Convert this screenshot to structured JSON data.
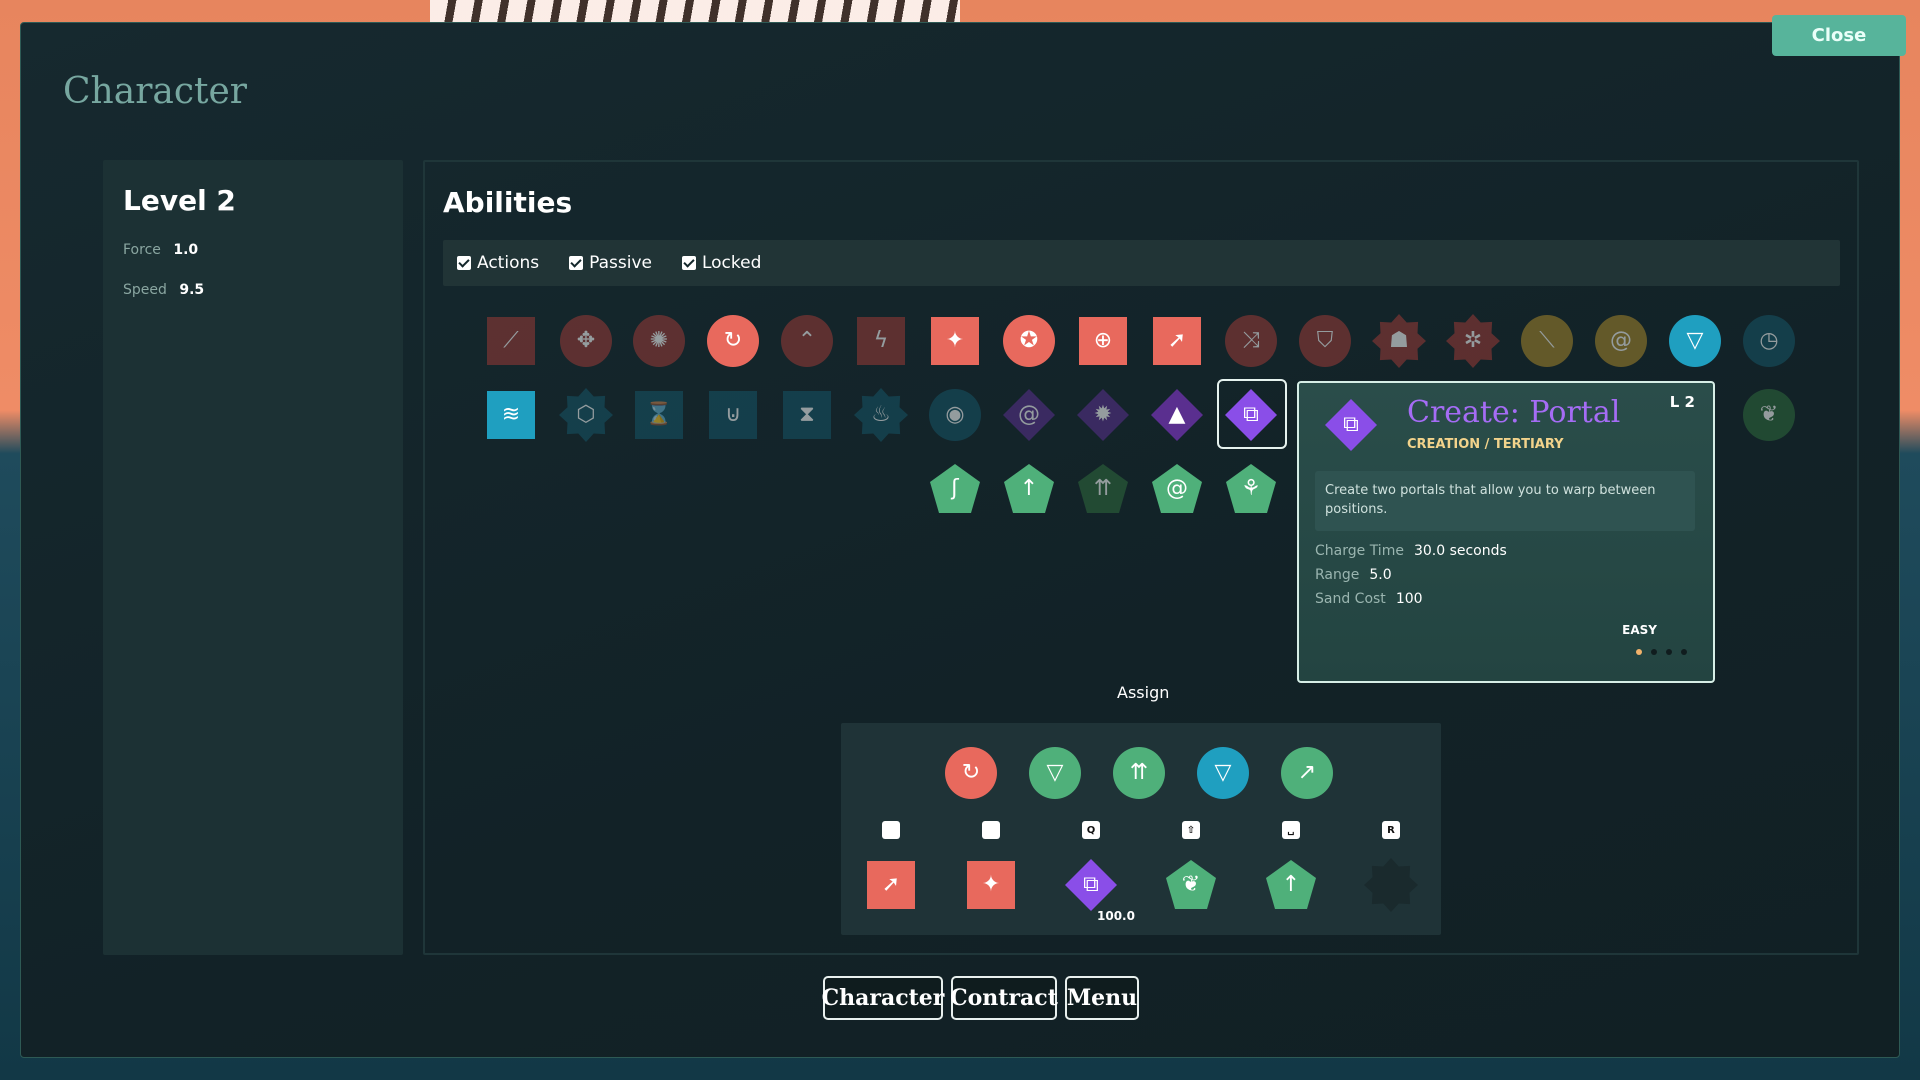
{
  "window": {
    "title": "Character",
    "close_label": "Close"
  },
  "stats": {
    "level": "Level 2",
    "items": [
      {
        "label": "Force",
        "value": "1.0"
      },
      {
        "label": "Speed",
        "value": "9.5"
      }
    ]
  },
  "abilities": {
    "title": "Abilities",
    "filters": [
      {
        "label": "Actions",
        "checked": true
      },
      {
        "label": "Passive",
        "checked": true
      },
      {
        "label": "Locked",
        "checked": true
      }
    ],
    "rows": [
      [
        {
          "icon": "claw-slash-icon",
          "color": "#9a3a36",
          "shape": "square",
          "locked": true
        },
        {
          "icon": "four-arrows-in-icon",
          "color": "#9a3a36",
          "shape": "circle",
          "locked": true
        },
        {
          "icon": "burst-arrows-icon",
          "color": "#9a3a36",
          "shape": "circle",
          "locked": true
        },
        {
          "icon": "spin-attack-icon",
          "color": "#e8695d",
          "shape": "circle",
          "locked": false
        },
        {
          "icon": "chevrons-up-icon",
          "color": "#9a3a36",
          "shape": "circle",
          "locked": true
        },
        {
          "icon": "lightning-icon",
          "color": "#9a3a36",
          "shape": "square",
          "locked": true
        },
        {
          "icon": "star-burst-icon",
          "color": "#e8695d",
          "shape": "square",
          "locked": false
        },
        {
          "icon": "pentagon-swirl-icon",
          "color": "#e8695d",
          "shape": "circle",
          "locked": false
        },
        {
          "icon": "target-icon",
          "color": "#e8695d",
          "shape": "square",
          "locked": false
        },
        {
          "icon": "dash-strike-icon",
          "color": "#e8695d",
          "shape": "square",
          "locked": false
        },
        {
          "icon": "split-arrows-icon",
          "color": "#9a3a36",
          "shape": "circle",
          "locked": true
        },
        {
          "icon": "shield-icon",
          "color": "#9a3a36",
          "shape": "circle",
          "locked": true
        },
        {
          "icon": "demon-face-icon",
          "color": "#9a3a36",
          "shape": "star",
          "locked": true
        },
        {
          "icon": "spider-icon",
          "color": "#9a3a36",
          "shape": "star",
          "locked": true
        },
        {
          "icon": "feather-blade-icon",
          "color": "#a6862a",
          "shape": "circle",
          "locked": true
        },
        {
          "icon": "spiral-icon",
          "color": "#a6862a",
          "shape": "circle",
          "locked": true
        },
        {
          "icon": "vortex-icon",
          "color": "#1f9fc0",
          "shape": "circle",
          "locked": false
        },
        {
          "icon": "stopwatch-icon",
          "color": "#165566",
          "shape": "circle",
          "locked": true
        }
      ],
      [
        {
          "icon": "wind-dash-icon",
          "color": "#1f9fc0",
          "shape": "square",
          "locked": false
        },
        {
          "icon": "cube-icon",
          "color": "#165566",
          "shape": "star",
          "locked": true
        },
        {
          "icon": "hourglass-lock-icon",
          "color": "#165566",
          "shape": "square",
          "locked": true
        },
        {
          "icon": "magnet-icon",
          "color": "#165566",
          "shape": "square",
          "locked": true
        },
        {
          "icon": "hourglass-icon",
          "color": "#165566",
          "shape": "square",
          "locked": true
        },
        {
          "icon": "sand-flame-icon",
          "color": "#165566",
          "shape": "star",
          "locked": true
        },
        {
          "icon": "eye-swirl-icon",
          "color": "#165566",
          "shape": "circle",
          "locked": true
        },
        {
          "icon": "portal-spiral-icon",
          "color": "#5a2f8f",
          "shape": "diamond",
          "locked": true
        },
        {
          "icon": "gear-burst-icon",
          "color": "#5a2f8f",
          "shape": "diamond",
          "locked": true
        },
        {
          "icon": "pyramid-icon",
          "color": "#5a2f8f",
          "shape": "diamond",
          "locked": false
        },
        {
          "icon": "portal-icon",
          "color": "#8a4ee8",
          "shape": "diamond",
          "locked": false
        },
        {
          "icon": "leaf-icon",
          "color": "#2f6a3c",
          "shape": "circle",
          "locked": true
        }
      ],
      [
        {
          "icon": "cane-icon",
          "color": "#4fb07a",
          "shape": "pentagon",
          "locked": false
        },
        {
          "icon": "up-arrow-icon",
          "color": "#4fb07a",
          "shape": "pentagon",
          "locked": false
        },
        {
          "icon": "triple-arrows-icon",
          "color": "#2f6a3c",
          "shape": "pentagon",
          "locked": true
        },
        {
          "icon": "swirl-icon",
          "color": "#4fb07a",
          "shape": "pentagon",
          "locked": false
        },
        {
          "icon": "sprout-icon",
          "color": "#4fb07a",
          "shape": "pentagon",
          "locked": false
        }
      ]
    ]
  },
  "tooltip": {
    "icon": "portal-icon",
    "title": "Create: Portal",
    "level": "L 2",
    "tags": "CREATION / TERTIARY",
    "description": "Create two portals that allow you to warp between positions.",
    "stats": [
      {
        "label": "Charge Time",
        "value": "30.0 seconds"
      },
      {
        "label": "Range",
        "value": "5.0"
      },
      {
        "label": "Sand Cost",
        "value": "100"
      }
    ],
    "difficulty": "EASY",
    "page_dots": 4,
    "active_dot": 0
  },
  "assign": {
    "label": "Assign",
    "top_row": [
      {
        "icon": "spin-attack-icon",
        "color": "#e8695d"
      },
      {
        "icon": "speed-gem-icon",
        "color": "#4fb07a"
      },
      {
        "icon": "triple-arrows-icon",
        "color": "#4fb07a"
      },
      {
        "icon": "vortex-icon",
        "color": "#1f9fc0"
      },
      {
        "icon": "leap-icon",
        "color": "#4fb07a"
      }
    ],
    "slots": [
      {
        "key": "mouse-left-icon",
        "key_label": "",
        "icon": "dash-strike-icon",
        "color": "#e8695d",
        "shape": "square"
      },
      {
        "key": "mouse-right-icon",
        "key_label": "",
        "icon": "star-burst-icon",
        "color": "#e8695d",
        "shape": "square"
      },
      {
        "key": "q-key-icon",
        "key_label": "Q",
        "icon": "portal-icon",
        "color": "#8a4ee8",
        "shape": "diamond",
        "value": "100.0"
      },
      {
        "key": "shift-key-icon",
        "key_label": "⇧",
        "icon": "leaf-icon",
        "color": "#4fb07a",
        "shape": "pentagon"
      },
      {
        "key": "space-key-icon",
        "key_label": "␣",
        "icon": "up-arrow-icon",
        "color": "#4fb07a",
        "shape": "pentagon"
      },
      {
        "key": "r-key-icon",
        "key_label": "R",
        "icon": "empty-slot-icon",
        "color": "#1a2a2d",
        "shape": "star"
      }
    ]
  },
  "nav": {
    "buttons": [
      "Character",
      "Contract",
      "Menu"
    ]
  }
}
